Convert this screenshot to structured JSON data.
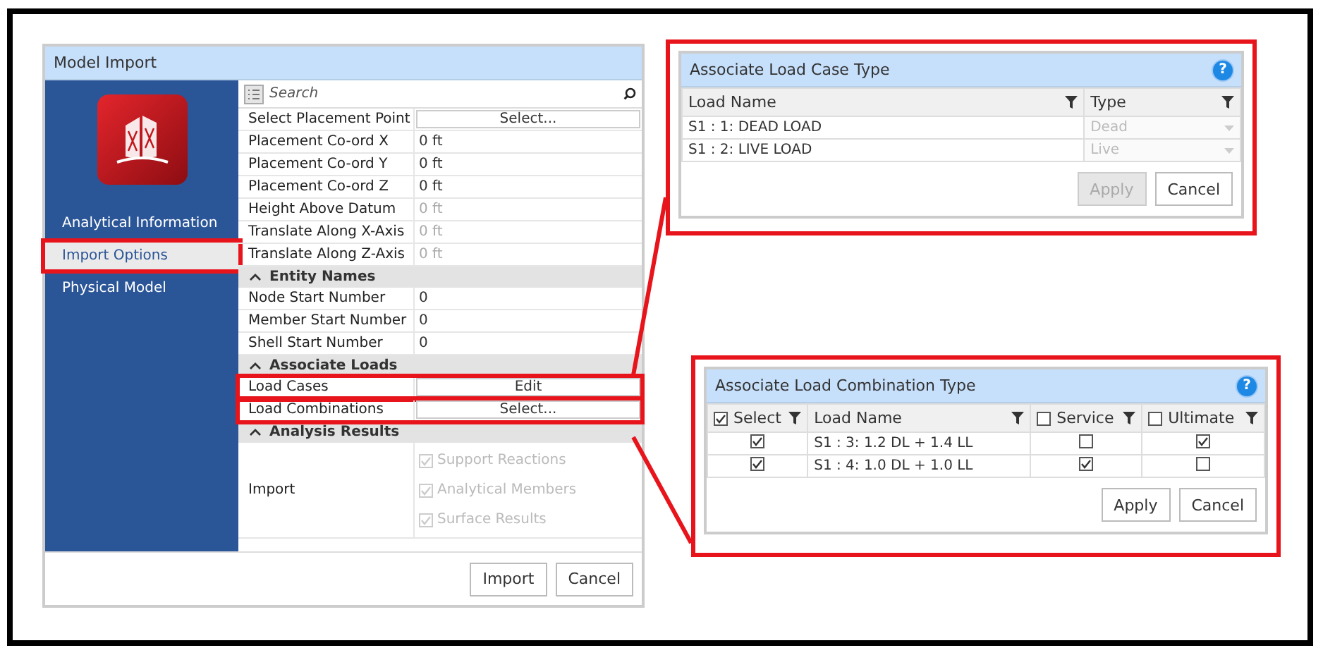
{
  "model_import": {
    "title": "Model Import",
    "sidebar": {
      "items": [
        {
          "label": "Analytical Information",
          "selected": false,
          "highlighted": false
        },
        {
          "label": "Import Options",
          "selected": true,
          "highlighted": true
        },
        {
          "label": "Physical Model",
          "selected": false,
          "highlighted": false
        }
      ]
    },
    "search": {
      "placeholder": "Search"
    },
    "rows": [
      {
        "kind": "button",
        "label": "Select Placement Point",
        "value": "Select...",
        "highlighted": false
      },
      {
        "kind": "value",
        "label": "Placement Co-ord X",
        "value": "0 ft",
        "disabled": false
      },
      {
        "kind": "value",
        "label": "Placement Co-ord Y",
        "value": "0 ft",
        "disabled": false
      },
      {
        "kind": "value",
        "label": "Placement Co-ord Z",
        "value": "0 ft",
        "disabled": false
      },
      {
        "kind": "value",
        "label": "Height Above Datum",
        "value": "0 ft",
        "disabled": true
      },
      {
        "kind": "value",
        "label": "Translate Along X-Axis",
        "value": "0 ft",
        "disabled": true
      },
      {
        "kind": "value",
        "label": "Translate Along Z-Axis",
        "value": "0 ft",
        "disabled": true
      },
      {
        "kind": "section",
        "label": "Entity Names",
        "expanded": true
      },
      {
        "kind": "value",
        "label": "Node Start Number",
        "value": "0",
        "disabled": false
      },
      {
        "kind": "value",
        "label": "Member Start Number",
        "value": "0",
        "disabled": false
      },
      {
        "kind": "value",
        "label": "Shell Start Number",
        "value": "0",
        "disabled": false
      },
      {
        "kind": "section",
        "label": "Associate Loads",
        "expanded": true
      },
      {
        "kind": "button",
        "label": "Load Cases",
        "value": "Edit",
        "highlighted": true
      },
      {
        "kind": "button",
        "label": "Load Combinations",
        "value": "Select...",
        "highlighted": true
      },
      {
        "kind": "section",
        "label": "Analysis Results",
        "expanded": true
      },
      {
        "kind": "checklist",
        "label": "Import",
        "options": [
          {
            "label": "Support Reactions",
            "checked": true,
            "disabled": true
          },
          {
            "label": "Analytical Members",
            "checked": true,
            "disabled": true
          },
          {
            "label": "Surface Results",
            "checked": true,
            "disabled": true
          }
        ]
      }
    ],
    "buttons": [
      "Import",
      "Cancel"
    ]
  },
  "load_case_dialog": {
    "title": "Associate Load Case Type",
    "help": "?",
    "columns": [
      "Load Name",
      "Type"
    ],
    "rows": [
      {
        "load_name": "S1 : 1: DEAD LOAD",
        "type": "Dead",
        "disabled": true
      },
      {
        "load_name": "S1 : 2: LIVE LOAD",
        "type": "Live",
        "disabled": true
      }
    ],
    "buttons": [
      {
        "label": "Apply",
        "disabled": true
      },
      {
        "label": "Cancel",
        "disabled": false
      }
    ]
  },
  "load_combination_dialog": {
    "title": "Associate Load Combination Type",
    "help": "?",
    "columns": [
      {
        "label": "Select",
        "kind": "check",
        "checked": true
      },
      {
        "label": "Load Name",
        "kind": "text"
      },
      {
        "label": "Service",
        "kind": "check",
        "checked": false
      },
      {
        "label": "Ultimate",
        "kind": "check",
        "checked": false
      }
    ],
    "rows": [
      {
        "select": true,
        "load_name": "S1 : 3: 1.2 DL + 1.4 LL",
        "service": false,
        "ultimate": true
      },
      {
        "select": true,
        "load_name": "S1 : 4: 1.0 DL + 1.0 LL",
        "service": true,
        "ultimate": false
      }
    ],
    "buttons": [
      {
        "label": "Apply",
        "disabled": false
      },
      {
        "label": "Cancel",
        "disabled": false
      }
    ]
  }
}
